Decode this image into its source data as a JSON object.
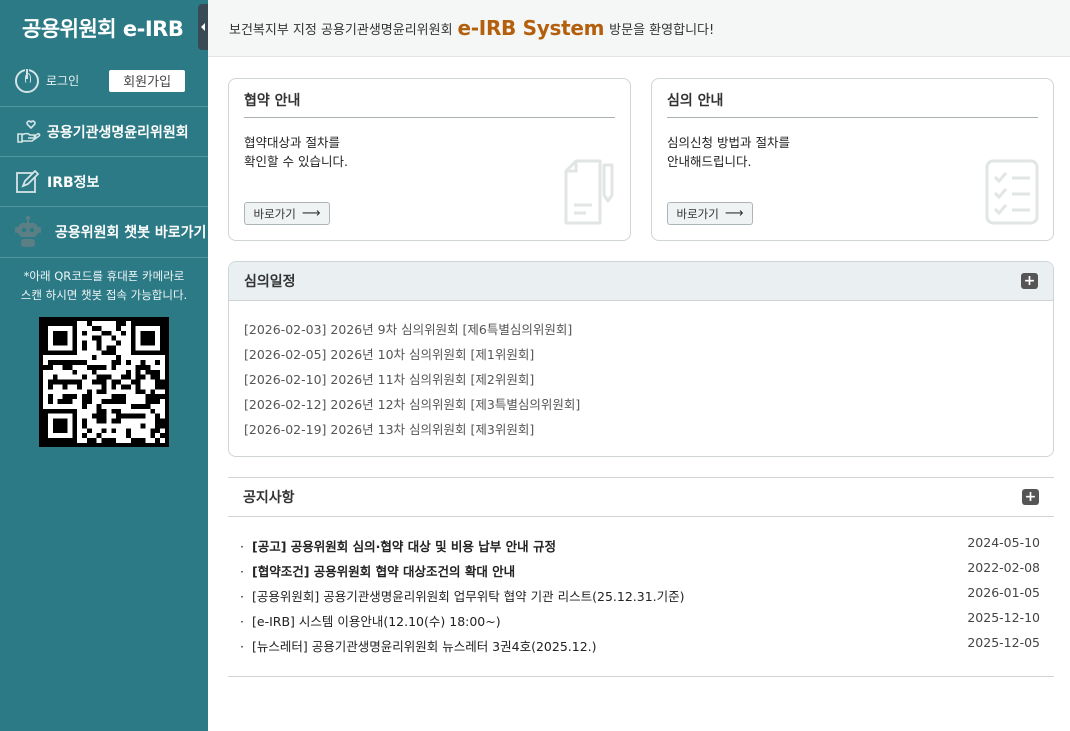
{
  "sidebar": {
    "logo": "공용위원회 e-IRB",
    "login_label": "로그인",
    "join_label": "회원가입",
    "menu": [
      {
        "label": "공용기관생명윤리위원회"
      },
      {
        "label": "IRB정보"
      },
      {
        "label": "공용위원회 챗봇 바로가기"
      }
    ],
    "qr_note_line1": "*아래 QR코드를 휴대폰 카메라로",
    "qr_note_line2": "스캔 하시면 챗봇 접속 가능합니다."
  },
  "topbar": {
    "prefix": "보건복지부 지정 공용기관생명윤리위원회",
    "brand": "e-IRB System",
    "suffix": "방문을 환영합니다!"
  },
  "cards": [
    {
      "title": "협약 안내",
      "desc_line1": "협약대상과 절차를",
      "desc_line2": "확인할 수 있습니다.",
      "button": "바로가기"
    },
    {
      "title": "심의 안내",
      "desc_line1": "심의신청 방법과 절차를",
      "desc_line2": "안내해드립니다.",
      "button": "바로가기"
    }
  ],
  "schedule": {
    "title": "심의일정",
    "items": [
      "[2026-02-03] 2026년 9차 심의위원회 [제6특별심의위원회]",
      "[2026-02-05] 2026년 10차 심의위원회 [제1위원회]",
      "[2026-02-10] 2026년 11차 심의위원회 [제2위원회]",
      "[2026-02-12] 2026년 12차 심의위원회 [제3특별심의위원회]",
      "[2026-02-19] 2026년 13차 심의위원회 [제3위원회]"
    ]
  },
  "notice": {
    "title": "공지사항",
    "bullet": "·",
    "items": [
      {
        "title": "[공고] 공용위원회 심의·협약 대상 및 비용 납부 안내 규정",
        "date": "2024-05-10"
      },
      {
        "title": "[협약조건] 공용위원회 협약 대상조건의 확대 안내",
        "date": "2022-02-08"
      },
      {
        "title": "[공용위원회] 공용기관생명윤리위원회 업무위탁 협약 기관 리스트(25.12.31.기준)",
        "date": "2026-01-05"
      },
      {
        "title": "[e-IRB] 시스템 이용안내(12.10(수) 18:00~)",
        "date": "2025-12-10"
      },
      {
        "title": "[뉴스레터] 공용기관생명윤리위원회 뉴스레터 3권4호(2025.12.)",
        "date": "2025-12-05"
      }
    ]
  },
  "colors": {
    "sidebar": "#2b7a85",
    "brand": "#b35f0c"
  }
}
